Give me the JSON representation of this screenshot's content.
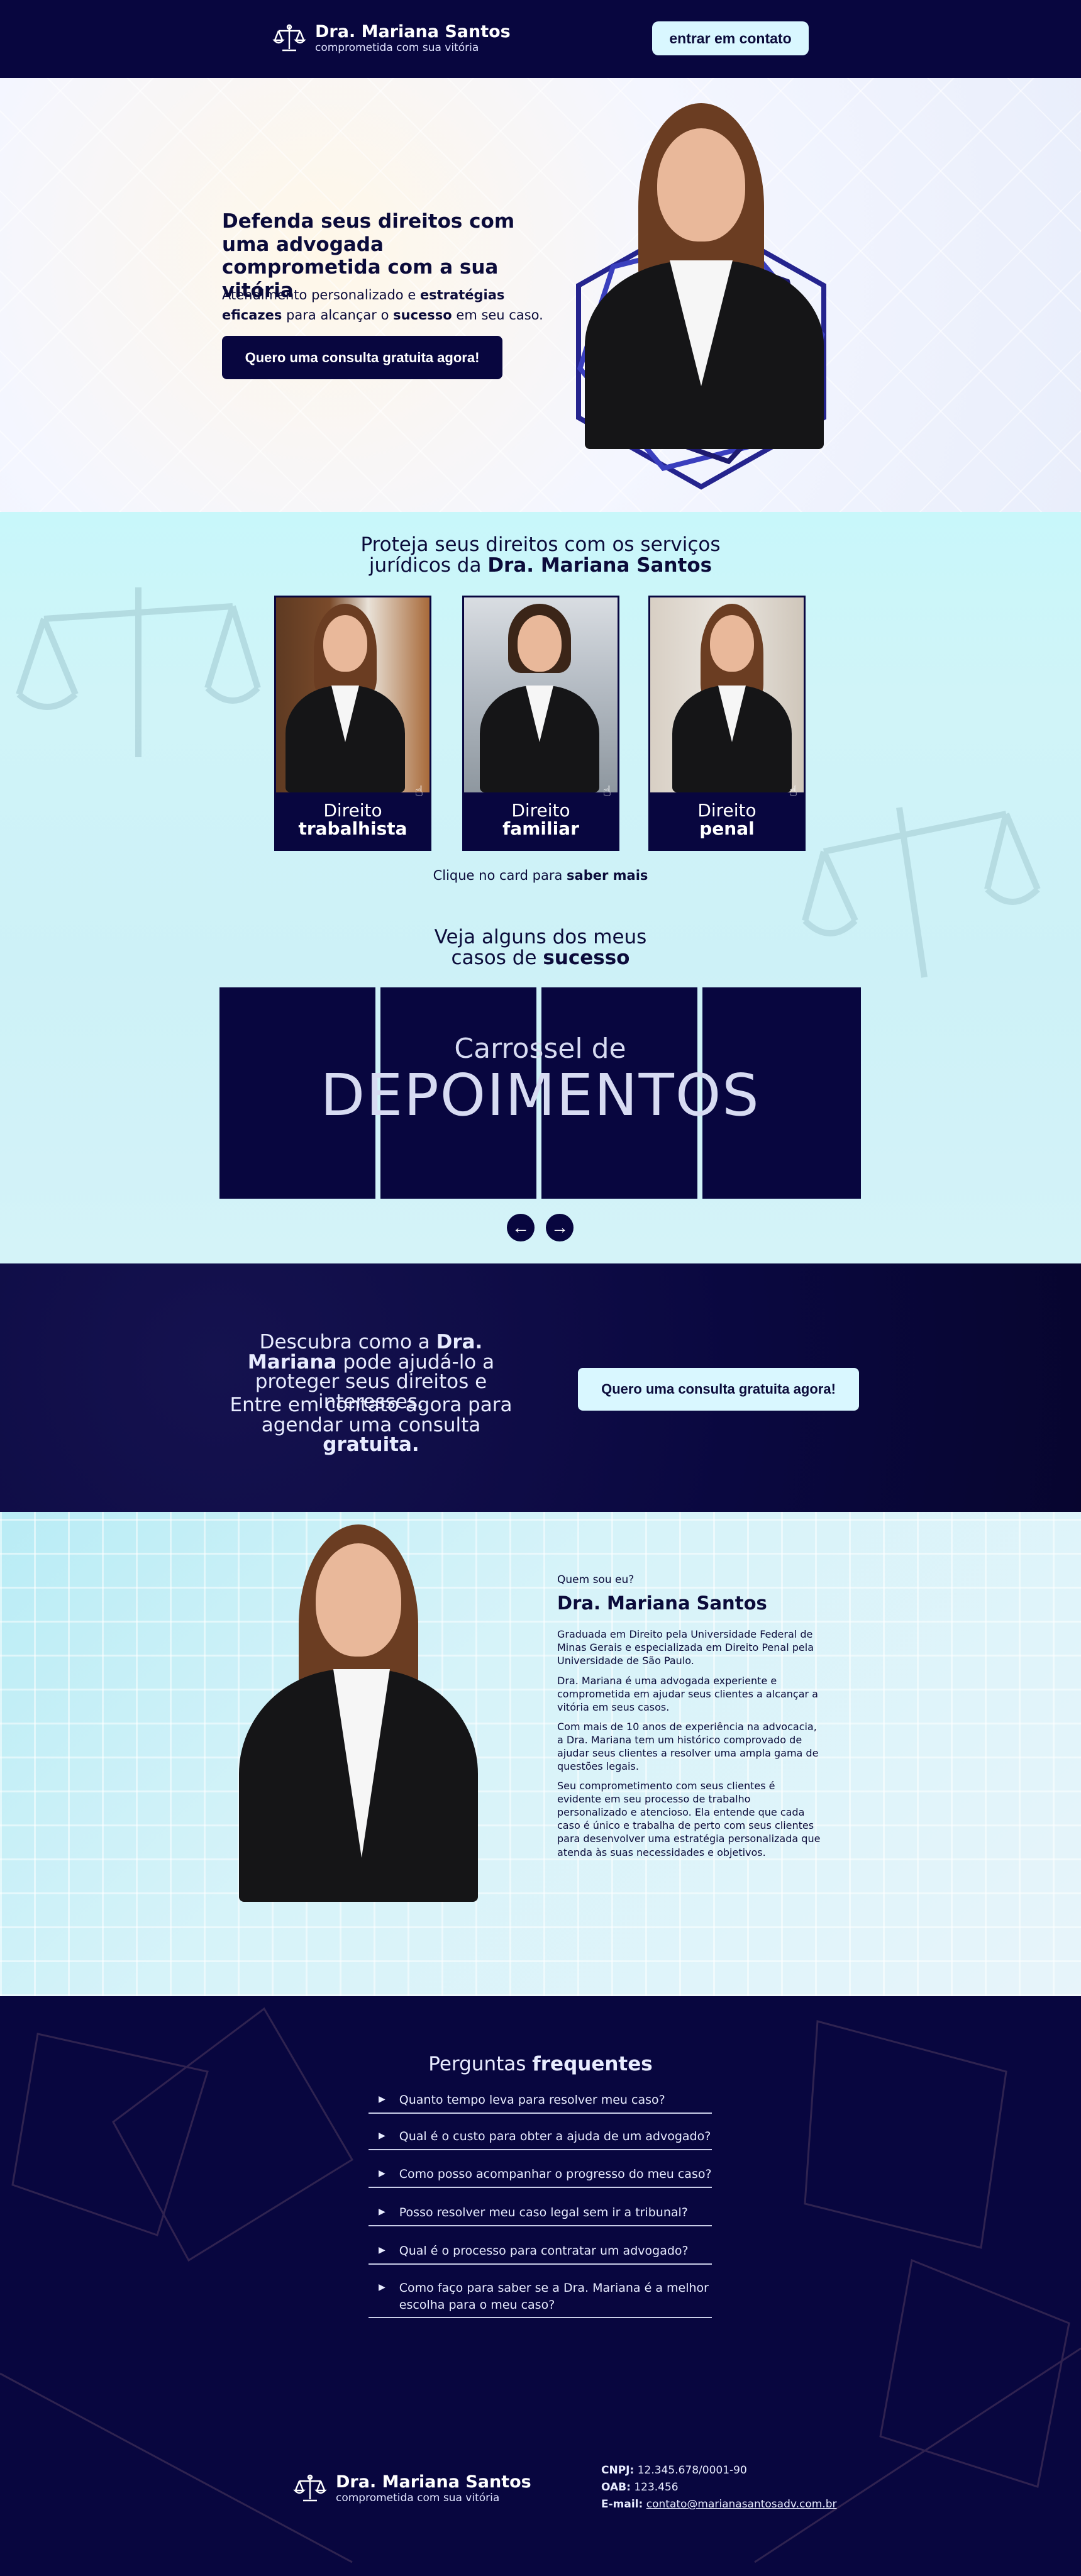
{
  "header": {
    "brand_name": "Dra. Mariana Santos",
    "brand_tagline": "comprometida com sua vitória",
    "contact_button": "entrar em contato"
  },
  "hero": {
    "title": "Defenda seus direitos com uma advogada comprometida com a sua vitória",
    "subtitle_parts": [
      "Atendimento personalizado e ",
      "estratégias eficazes",
      " para alcançar o ",
      "sucesso",
      " em seu caso."
    ],
    "cta_button": "Quero uma consulta gratuita agora!"
  },
  "services": {
    "title_line1": "Proteja seus direitos com os serviços",
    "title_line2_normal": "jurídicos da ",
    "title_line2_bold": "Dra. Mariana Santos",
    "cards": [
      {
        "line1": "Direito",
        "line2": "trabalhista"
      },
      {
        "line1": "Direito",
        "line2": "familiar"
      },
      {
        "line1": "Direito",
        "line2": "penal"
      }
    ],
    "hint_normal": "Clique no card para ",
    "hint_bold": "saber mais"
  },
  "testimonials": {
    "title_line1": "Veja alguns dos meus",
    "title_line2_normal": "casos de ",
    "title_line2_bold": "sucesso",
    "carousel_caption_small": "Carrossel de",
    "carousel_caption_big": "DEPOIMENTOS"
  },
  "cta": {
    "text1_normal": "Descubra como a ",
    "text1_bold": "Dra. Mariana",
    "text1_rest": "pode ajudá-lo a proteger seus direitos e interesses.",
    "text2_normal": "Entre em contato agora para agendar uma consulta ",
    "text2_bold": "gratuita.",
    "button": "Quero uma consulta gratuita agora!"
  },
  "about": {
    "eyebrow": "Quem sou eu?",
    "name": "Dra. Mariana Santos",
    "paragraphs": [
      "Graduada em Direito pela Universidade Federal de Minas Gerais e especializada em Direito Penal pela Universidade de São Paulo.",
      "Dra. Mariana é uma advogada experiente e comprometida em ajudar seus clientes a alcançar a vitória em seus casos.",
      "Com mais de 10 anos de experiência na advocacia, a Dra. Mariana tem um histórico comprovado de ajudar seus clientes a resolver uma ampla gama de questões legais.",
      "Seu comprometimento com seus clientes é evidente em seu processo de trabalho personalizado e atencioso. Ela entende que cada caso é único e trabalha de perto com seus clientes para desenvolver uma estratégia personalizada que atenda às suas necessidades e objetivos."
    ]
  },
  "faq": {
    "title_normal": "Perguntas ",
    "title_bold": "frequentes",
    "items": [
      "Quanto tempo leva para resolver meu caso?",
      "Qual é o custo para obter a ajuda de um advogado?",
      "Como posso acompanhar o progresso do meu caso?",
      "Posso resolver meu caso legal sem ir a tribunal?",
      "Qual é o processo para contratar um advogado?",
      "Como faço para saber se a Dra. Mariana é a melhor escolha para o meu caso?"
    ]
  },
  "footer": {
    "brand_name": "Dra. Mariana Santos",
    "brand_tagline": "comprometida com sua vitória",
    "cnpj_label": "CNPJ:",
    "cnpj_value": "12.345.678/0001-90",
    "oab_label": "OAB:",
    "oab_value": "123.456",
    "email_label": "E-mail:",
    "email_value": "contato@marianasantosadv.com.br"
  },
  "colors": {
    "navy": "#08063f",
    "light_cyan": "#d9f7ff",
    "section_cyan": "#cdf1f7"
  },
  "icons": [
    "scales-of-justice-icon",
    "click-hand-icon",
    "arrow-left-icon",
    "arrow-right-icon",
    "triangle-right-icon"
  ]
}
